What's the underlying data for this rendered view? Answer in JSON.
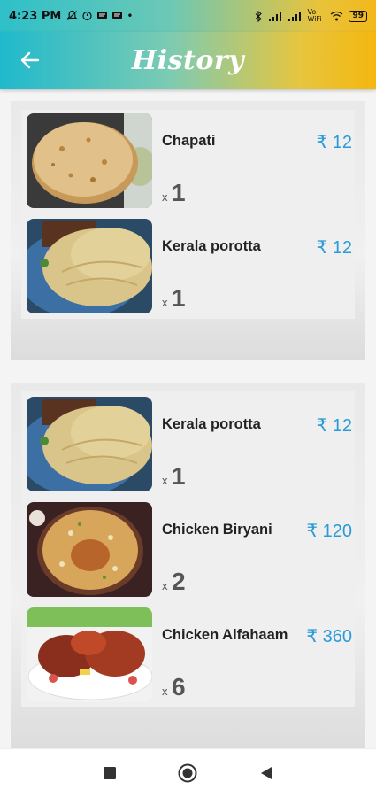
{
  "status_bar": {
    "time": "4:23 PM",
    "battery": "99",
    "network": "Vo WiFi"
  },
  "app_bar": {
    "title": "History",
    "back_icon": "arrow-left-icon"
  },
  "orders": [
    {
      "items": [
        {
          "name": "Chapati",
          "price": "₹ 12",
          "qty_prefix": "x",
          "qty": "1",
          "image": "chapati"
        },
        {
          "name": "Kerala porotta",
          "price": "₹ 12",
          "qty_prefix": "x",
          "qty": "1",
          "image": "porotta"
        }
      ]
    },
    {
      "items": [
        {
          "name": "Kerala porotta",
          "price": "₹ 12",
          "qty_prefix": "x",
          "qty": "1",
          "image": "porotta"
        },
        {
          "name": "Chicken Biryani",
          "price": "₹ 120",
          "qty_prefix": "x",
          "qty": "2",
          "image": "biryani"
        },
        {
          "name": "Chicken Alfahaam",
          "price": "₹ 360",
          "qty_prefix": "x",
          "qty": "6",
          "image": "alfahaam"
        }
      ]
    }
  ],
  "nav_bar": {
    "buttons": [
      "recents-square-icon",
      "home-circle-icon",
      "back-triangle-icon"
    ]
  },
  "colors": {
    "price": "#2b9ad8",
    "gradient_start": "#1fb9cc",
    "gradient_end": "#f4b70f"
  }
}
